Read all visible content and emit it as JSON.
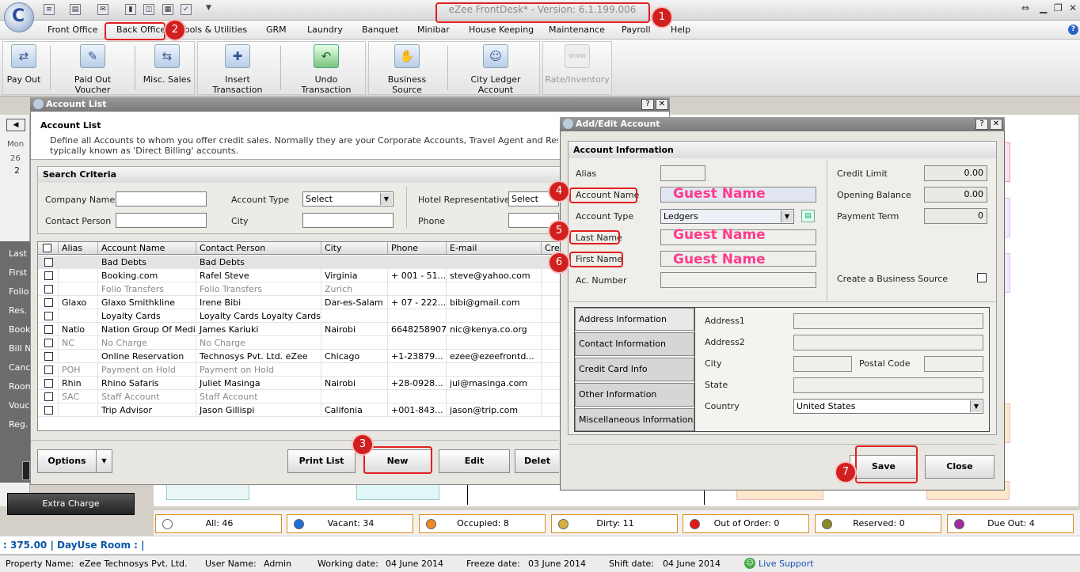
{
  "app": {
    "title": "eZee FrontDesk* - Version: 6.1.199.006"
  },
  "menu": [
    "Front Office",
    "Back Office",
    "Tools & Utilities",
    "GRM",
    "Laundry",
    "Banquet",
    "Minibar",
    "House Keeping",
    "Maintenance",
    "Payroll",
    "Help"
  ],
  "ribbon": {
    "buttons": [
      "Pay Out",
      "Paid Out Voucher",
      "Misc. Sales",
      "Insert Transaction",
      "Undo Transaction",
      "Business Source",
      "City Ledger Account",
      "Rate/Inventory"
    ],
    "rate_icon_text": "www"
  },
  "left_panel": {
    "items": [
      "Last",
      "First",
      "Folio",
      "Res.",
      "Book",
      "Bill N",
      "Canc",
      "Room",
      "Vouc",
      "Reg."
    ],
    "calendar_day": "Mon",
    "calendar_date": "26",
    "calendar_num": "2",
    "extra_charge": "Extra Charge"
  },
  "account_list": {
    "window_title": "Account List",
    "heading": "Account List",
    "description_line1": "Define all Accounts to whom you offer credit sales. Normally they are your Corporate Accounts, Travel Agent and Reservation Websit",
    "description_line2": "typically known as 'Direct Billing' accounts.",
    "search_title": "Search Criteria",
    "labels": {
      "company_name": "Company Name",
      "contact_person": "Contact Person",
      "account_type": "Account Type",
      "city": "City",
      "hotel_rep": "Hotel Representative",
      "phone": "Phone"
    },
    "account_type_value": "Select",
    "hotel_rep_value": "Select",
    "columns": [
      "Alias",
      "Account Name",
      "Contact Person",
      "City",
      "Phone",
      "E-mail",
      "Cre"
    ],
    "rows": [
      {
        "alias": "",
        "name": "Bad Debts",
        "contact": "Bad Debts",
        "city": "",
        "phone": "",
        "email": "",
        "inactive": false,
        "selected": true
      },
      {
        "alias": "",
        "name": "Booking.com",
        "contact": "Rafel Steve",
        "city": "Virginia",
        "phone": "+ 001 - 51...",
        "email": "steve@yahoo.com",
        "inactive": false,
        "selected": false
      },
      {
        "alias": "",
        "name": "Folio Transfers",
        "contact": "Folio Transfers",
        "city": "Zurich",
        "phone": "",
        "email": "",
        "inactive": true,
        "selected": false
      },
      {
        "alias": "Glaxo",
        "name": "Glaxo Smithkline",
        "contact": "Irene Bibi",
        "city": "Dar-es-Salam",
        "phone": "+ 07 - 222...",
        "email": "bibi@gmail.com",
        "inactive": false,
        "selected": false
      },
      {
        "alias": "",
        "name": "Loyalty Cards",
        "contact": "Loyalty Cards Loyalty Cards",
        "city": "",
        "phone": "",
        "email": "",
        "inactive": false,
        "selected": false
      },
      {
        "alias": "Natio",
        "name": "Nation Group Of Media",
        "contact": "James Kariuki",
        "city": "Nairobi",
        "phone": "6648258907",
        "email": "nic@kenya.co.org",
        "inactive": false,
        "selected": false
      },
      {
        "alias": "NC",
        "name": "No Charge",
        "contact": "No Charge",
        "city": "",
        "phone": "",
        "email": "",
        "inactive": true,
        "selected": false
      },
      {
        "alias": "",
        "name": "Online Reservation",
        "contact": "Technosys Pvt. Ltd. eZee",
        "city": "Chicago",
        "phone": "+1-23879...",
        "email": "ezee@ezeefrontd...",
        "inactive": false,
        "selected": false
      },
      {
        "alias": "POH",
        "name": "Payment on Hold",
        "contact": "Payment on Hold",
        "city": "",
        "phone": "",
        "email": "",
        "inactive": true,
        "selected": false
      },
      {
        "alias": "Rhin",
        "name": "Rhino Safaris",
        "contact": "Juliet Masinga",
        "city": "Nairobi",
        "phone": "+28-0928...",
        "email": "jul@masinga.com",
        "inactive": false,
        "selected": false
      },
      {
        "alias": "SAC",
        "name": "Staff Account",
        "contact": "Staff Account",
        "city": "",
        "phone": "",
        "email": "",
        "inactive": true,
        "selected": false
      },
      {
        "alias": "",
        "name": "Trip Advisor",
        "contact": "Jason Gillispi",
        "city": "Califonia",
        "phone": "+001-843...",
        "email": "jason@trip.com",
        "inactive": false,
        "selected": false
      }
    ],
    "buttons": {
      "options": "Options",
      "print": "Print List",
      "new": "New",
      "edit": "Edit",
      "delete": "Delet"
    }
  },
  "add_edit": {
    "window_title": "Add/Edit Account",
    "section_title": "Account Information",
    "labels": {
      "alias": "Alias",
      "account_name": "Account Name",
      "account_type": "Account Type",
      "last_name": "Last Name",
      "first_name": "First Name",
      "ac_number": "Ac. Number",
      "credit_limit": "Credit Limit",
      "opening_balance": "Opening Balance",
      "payment_term": "Payment Term",
      "create_bs": "Create a Business Source"
    },
    "values": {
      "account_name": "Guest Name",
      "account_type": "Ledgers",
      "last_name": "Guest Name",
      "first_name": "Guest Name",
      "credit_limit": "0.00",
      "opening_balance": "0.00",
      "payment_term": "0"
    },
    "tabs": [
      "Address Information",
      "Contact Information",
      "Credit Card Info",
      "Other Information",
      "Miscellaneous Information"
    ],
    "address": {
      "address1": "Address1",
      "address2": "Address2",
      "city": "City",
      "postal_code": "Postal Code",
      "state": "State",
      "country": "Country",
      "country_value": "United States"
    },
    "buttons": {
      "save": "Save",
      "close": "Close"
    }
  },
  "annotations": [
    "1",
    "2",
    "3",
    "4",
    "5",
    "6",
    "7"
  ],
  "status": [
    {
      "label": "All: 46",
      "color": "#ffffff"
    },
    {
      "label": "Vacant: 34",
      "color": "#1e6fd9"
    },
    {
      "label": "Occupied: 8",
      "color": "#f08a24"
    },
    {
      "label": "Dirty: 11",
      "color": "#d8b040"
    },
    {
      "label": "Out of Order: 0",
      "color": "#e01818"
    },
    {
      "label": "Reserved: 0",
      "color": "#8a8a2a"
    },
    {
      "label": "Due Out: 4",
      "color": "#a02aa0"
    }
  ],
  "dayuse": ": 375.00 | DayUse Room : |",
  "footer": {
    "property_label": "Property Name:",
    "property_value": "eZee Technosys Pvt. Ltd.",
    "user_label": "User Name:",
    "user_value": "Admin",
    "working_label": "Working date:",
    "working_value": "04 June 2014",
    "freeze_label": "Freeze date:",
    "freeze_value": "03 June 2014",
    "shift_label": "Shift date:",
    "shift_value": "04 June 2014",
    "support": "Live Support"
  }
}
